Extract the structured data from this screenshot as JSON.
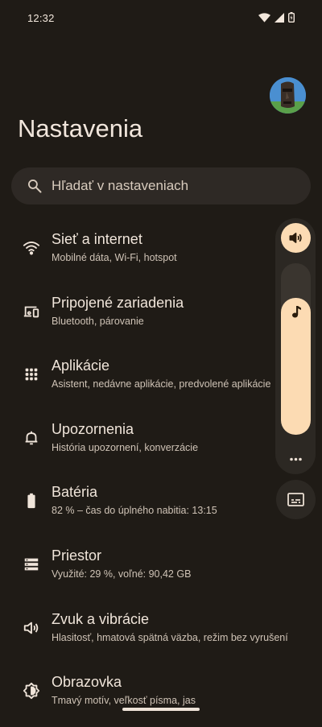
{
  "status_bar": {
    "time": "12:32",
    "icons": [
      "wifi-icon",
      "cellular-signal-icon",
      "battery-icon"
    ]
  },
  "header": {
    "title": "Nastavenia",
    "avatar": "account-avatar"
  },
  "search": {
    "placeholder": "Hľadať v nastaveniach",
    "icon": "search-icon"
  },
  "settings": [
    {
      "icon": "wifi-icon",
      "title": "Sieť a internet",
      "subtitle": "Mobilné dáta, Wi‑Fi, hotspot"
    },
    {
      "icon": "connected-devices-icon",
      "title": "Pripojené zariadenia",
      "subtitle": "Bluetooth, párovanie"
    },
    {
      "icon": "apps-grid-icon",
      "title": "Aplikácie",
      "subtitle": "Asistent, nedávne aplikácie, predvolené aplikácie"
    },
    {
      "icon": "bell-icon",
      "title": "Upozornenia",
      "subtitle": "História upozornení, konverzácie"
    },
    {
      "icon": "battery-icon",
      "title": "Batéria",
      "subtitle": "82 % – čas do úplného nabitia: 13:15"
    },
    {
      "icon": "storage-icon",
      "title": "Priestor",
      "subtitle": "Využité: 29 %, voľné: 90,42 GB"
    },
    {
      "icon": "speaker-icon",
      "title": "Zvuk a vibrácie",
      "subtitle": "Hlasitosť, hmatová spätná väzba, režim bez vyrušení"
    },
    {
      "icon": "brightness-icon",
      "title": "Obrazovka",
      "subtitle": "Tmavý motív, veľkosť písma, jas"
    }
  ],
  "volume_panel": {
    "stream_icon": "speaker-icon",
    "slider_icon": "music-note-icon",
    "media_level": 0.8,
    "more_icon": "more-horiz-icon",
    "caption_icon": "live-caption-icon",
    "accent": "#fcdbb3"
  },
  "colors": {
    "background": "#1f1b16",
    "surface": "#2e2925",
    "text": "#f0e5da",
    "accent": "#fcdbb3"
  }
}
